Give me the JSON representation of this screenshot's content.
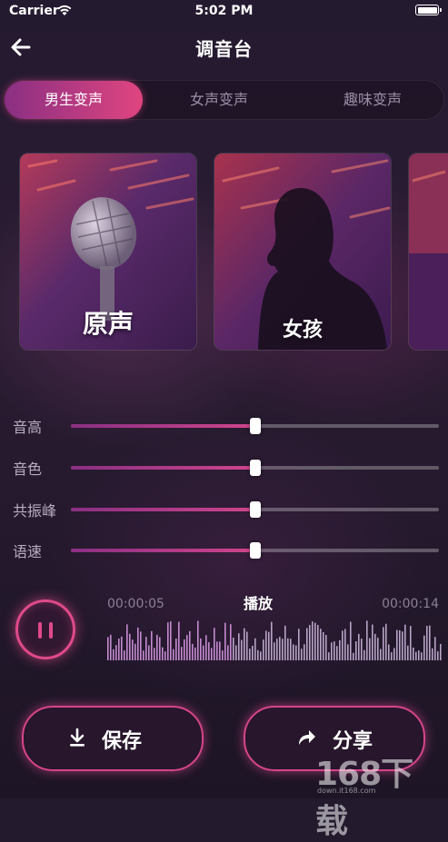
{
  "status_bar": {
    "carrier": "Carrier",
    "time": "5:02 PM"
  },
  "nav": {
    "title": "调音台",
    "back_icon": "arrow-left-icon"
  },
  "tabs": [
    {
      "label": "男生变声",
      "active": true
    },
    {
      "label": "女声变声",
      "active": false
    },
    {
      "label": "趣味变声",
      "active": false
    }
  ],
  "voice_cards": [
    {
      "label": "原声",
      "image": "microphone"
    },
    {
      "label": "女孩",
      "image": "silhouette"
    }
  ],
  "sliders": [
    {
      "label": "音高",
      "value": 0.5
    },
    {
      "label": "音色",
      "value": 0.5
    },
    {
      "label": "共振峰",
      "value": 0.5
    },
    {
      "label": "语速",
      "value": 0.5
    }
  ],
  "player": {
    "current_time": "00:00:05",
    "total_time": "00:00:14",
    "play_label": "播放",
    "state_icon": "pause-icon"
  },
  "actions": {
    "save_label": "保存",
    "save_icon": "download-icon",
    "share_label": "分享",
    "share_icon": "share-arrow-icon"
  },
  "watermark": {
    "text": "168下载",
    "sub": "down.it168.com"
  },
  "colors": {
    "accent": "#e04a8a",
    "accent_dark": "#8a2f83",
    "background": "#231a2e"
  }
}
